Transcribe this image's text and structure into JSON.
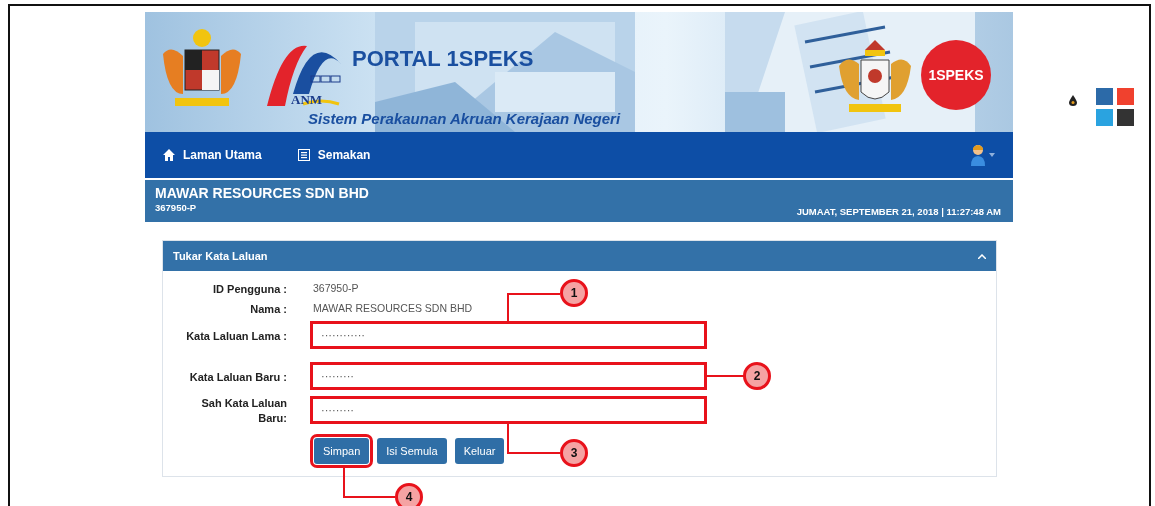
{
  "header": {
    "title": "PORTAL 1SPEKS",
    "agency": "ANM",
    "subtitle": "Sistem Perakaunan Akruan Kerajaan Negeri",
    "badge": "1SPEKS"
  },
  "nav": {
    "items": [
      {
        "label": "Laman Utama"
      },
      {
        "label": "Semakan"
      }
    ]
  },
  "company": {
    "name": "MAWAR RESOURCES SDN BHD",
    "id": "367950-P",
    "datetime": "JUMAAT, SEPTEMBER 21, 2018 | 11:27:48 AM"
  },
  "panel": {
    "title": "Tukar Kata Laluan",
    "info": [
      {
        "label": "ID Pengguna :",
        "value": "367950-P"
      },
      {
        "label": "Nama :",
        "value": "MAWAR RESOURCES SDN BHD"
      }
    ],
    "fields": [
      {
        "label": "Kata Laluan Lama :",
        "value": "············",
        "callout": "1"
      },
      {
        "label": "Kata Laluan Baru :",
        "value": "·········",
        "callout": "2"
      },
      {
        "label": "Sah Kata Laluan Baru:",
        "value": "·········",
        "callout": "3"
      }
    ],
    "buttons": [
      {
        "label": "Simpan",
        "callout": "4"
      },
      {
        "label": "Isi Semula"
      },
      {
        "label": "Keluar"
      }
    ]
  },
  "theme_swatches": [
    {
      "color": "#2c6aa8"
    },
    {
      "color": "#f0412e"
    },
    {
      "color": "#2aa3e0"
    },
    {
      "color": "#333333"
    }
  ]
}
